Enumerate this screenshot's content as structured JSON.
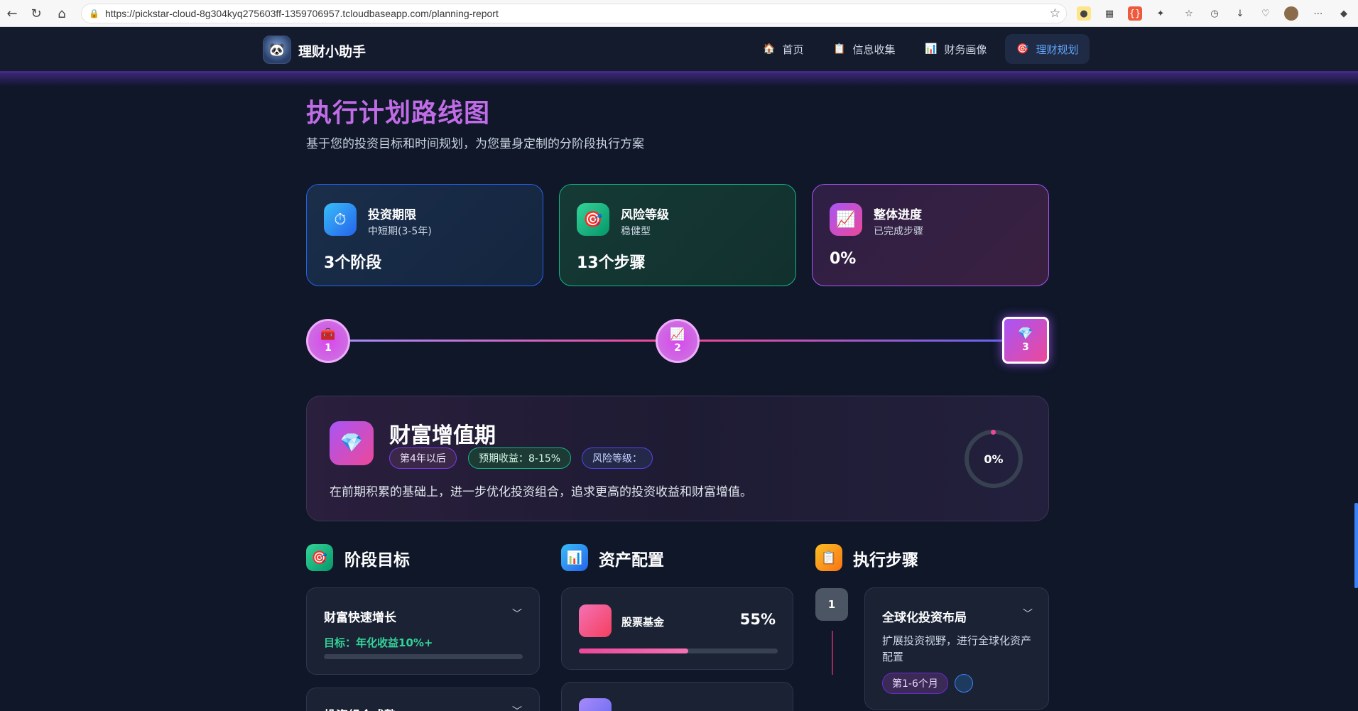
{
  "browser": {
    "url": "https://pickstar-cloud-8g304kyq275603ff-1359706957.tcloudbaseapp.com/planning-report"
  },
  "header": {
    "app_title": "理财小助手",
    "nav": [
      {
        "label": "首页",
        "icon": "home-icon"
      },
      {
        "label": "信息收集",
        "icon": "clipboard-icon"
      },
      {
        "label": "财务画像",
        "icon": "bar-chart-icon"
      },
      {
        "label": "理财规划",
        "icon": "target-icon",
        "active": true
      }
    ]
  },
  "page": {
    "title": "执行计划路线图",
    "subtitle": "基于您的投资目标和时间规划，为您量身定制的分阶段执行方案"
  },
  "summary_cards": [
    {
      "label": "投资期限",
      "sub": "中短期(3-5年)",
      "value": "3个阶段",
      "icon": "stopwatch-icon"
    },
    {
      "label": "风险等级",
      "sub": "稳健型",
      "value": "13个步骤",
      "icon": "target-icon"
    },
    {
      "label": "整体进度",
      "sub": "已完成步骤",
      "value": "0%",
      "icon": "trend-chart-icon"
    }
  ],
  "stages": [
    {
      "number": "1",
      "icon": "treasure-chest-icon",
      "active": false
    },
    {
      "number": "2",
      "icon": "trend-chart-icon",
      "active": false
    },
    {
      "number": "3",
      "icon": "gem-icon",
      "active": true
    }
  ],
  "phase": {
    "title": "财富增值期",
    "period": "第4年以后",
    "expected_return": "预期收益：8-15%",
    "risk_level": "风险等级：",
    "description": "在前期积累的基础上，进一步优化投资组合，追求更高的投资收益和财富增值。",
    "progress": "0%",
    "progress_value": 0
  },
  "sections": {
    "goals_title": "阶段目标",
    "assets_title": "资产配置",
    "steps_title": "执行步骤"
  },
  "goals": [
    {
      "title": "财富快速增长",
      "target": "目标：年化收益10%+",
      "progress_value": 0
    },
    {
      "title": "投资组合成熟",
      "target": "",
      "progress_value": 0
    }
  ],
  "assets": [
    {
      "name": "股票基金",
      "percent": "55%",
      "value": 55,
      "color": "#ec4899"
    },
    {
      "name": "",
      "percent": "",
      "value": 0,
      "color": "#8b5cf6"
    }
  ],
  "steps": [
    {
      "number": "1",
      "title": "全球化投资布局",
      "description": "扩展投资视野，进行全球化资产配置",
      "duration": "第1-6个月"
    }
  ],
  "colors": {
    "accent_purple": "#c06ce6",
    "accent_blue": "#60a5fa",
    "accent_pink": "#ec4899",
    "success_green": "#34d399",
    "background": "#0f1729"
  }
}
